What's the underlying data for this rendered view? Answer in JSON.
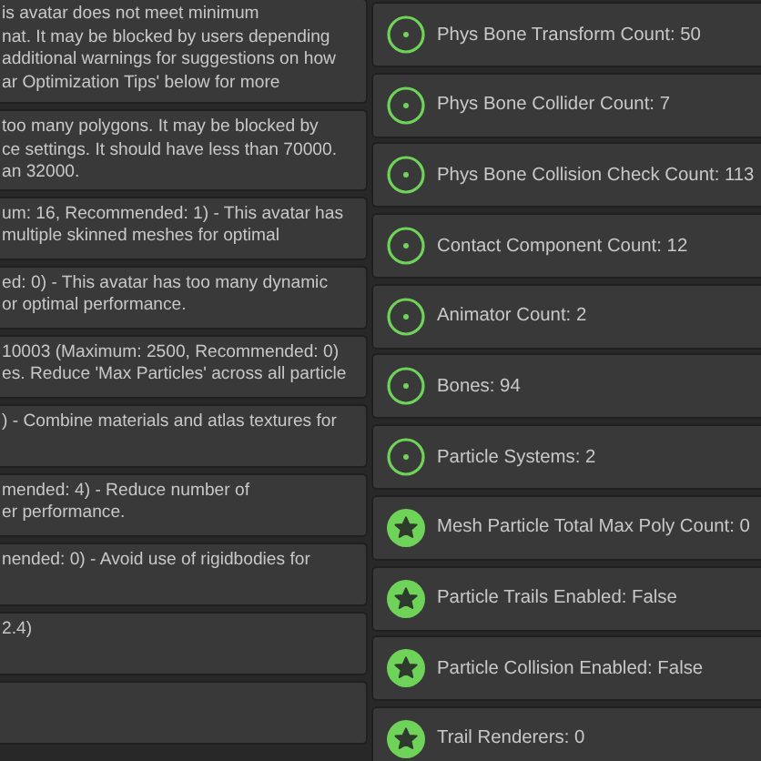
{
  "messages": [
    {
      "lines": [
        "is avatar does not meet minimum",
        "nat. It may be blocked by users depending",
        "additional warnings for suggestions on how",
        "ar Optimization Tips' below for more"
      ]
    },
    {
      "lines": [
        "too many polygons. It may be blocked by",
        "ce settings. It should have less than 70000.",
        "an 32000."
      ]
    },
    {
      "lines": [
        "um: 16, Recommended: 1) - This avatar has",
        "multiple skinned meshes for optimal"
      ]
    },
    {
      "lines": [
        "ed: 0) - This avatar has too many dynamic",
        "or optimal performance."
      ]
    },
    {
      "lines": [
        "10003 (Maximum: 2500, Recommended: 0)",
        "es. Reduce 'Max Particles' across all particle"
      ]
    },
    {
      "lines": [
        ") - Combine materials and atlas textures for"
      ]
    },
    {
      "lines": [
        "mended: 4) - Reduce number of",
        "er performance."
      ]
    },
    {
      "lines": [
        "nended: 0) - Avoid use of rigidbodies for"
      ]
    },
    {
      "lines": [
        "2.4)"
      ]
    }
  ],
  "stats": [
    {
      "kind": "good",
      "label": "Phys Bone Transform Count: 50"
    },
    {
      "kind": "good",
      "label": "Phys Bone Collider Count: 7"
    },
    {
      "kind": "good",
      "label": "Phys Bone Collision Check Count: 113"
    },
    {
      "kind": "good",
      "label": "Contact Component Count: 12"
    },
    {
      "kind": "good",
      "label": "Animator Count: 2"
    },
    {
      "kind": "good",
      "label": "Bones: 94"
    },
    {
      "kind": "good",
      "label": "Particle Systems: 2"
    },
    {
      "kind": "excellent",
      "label": "Mesh Particle Total Max Poly Count: 0"
    },
    {
      "kind": "excellent",
      "label": "Particle Trails Enabled: False"
    },
    {
      "kind": "excellent",
      "label": "Particle Collision Enabled: False"
    },
    {
      "kind": "excellent",
      "label": "Trail Renderers: 0"
    }
  ]
}
